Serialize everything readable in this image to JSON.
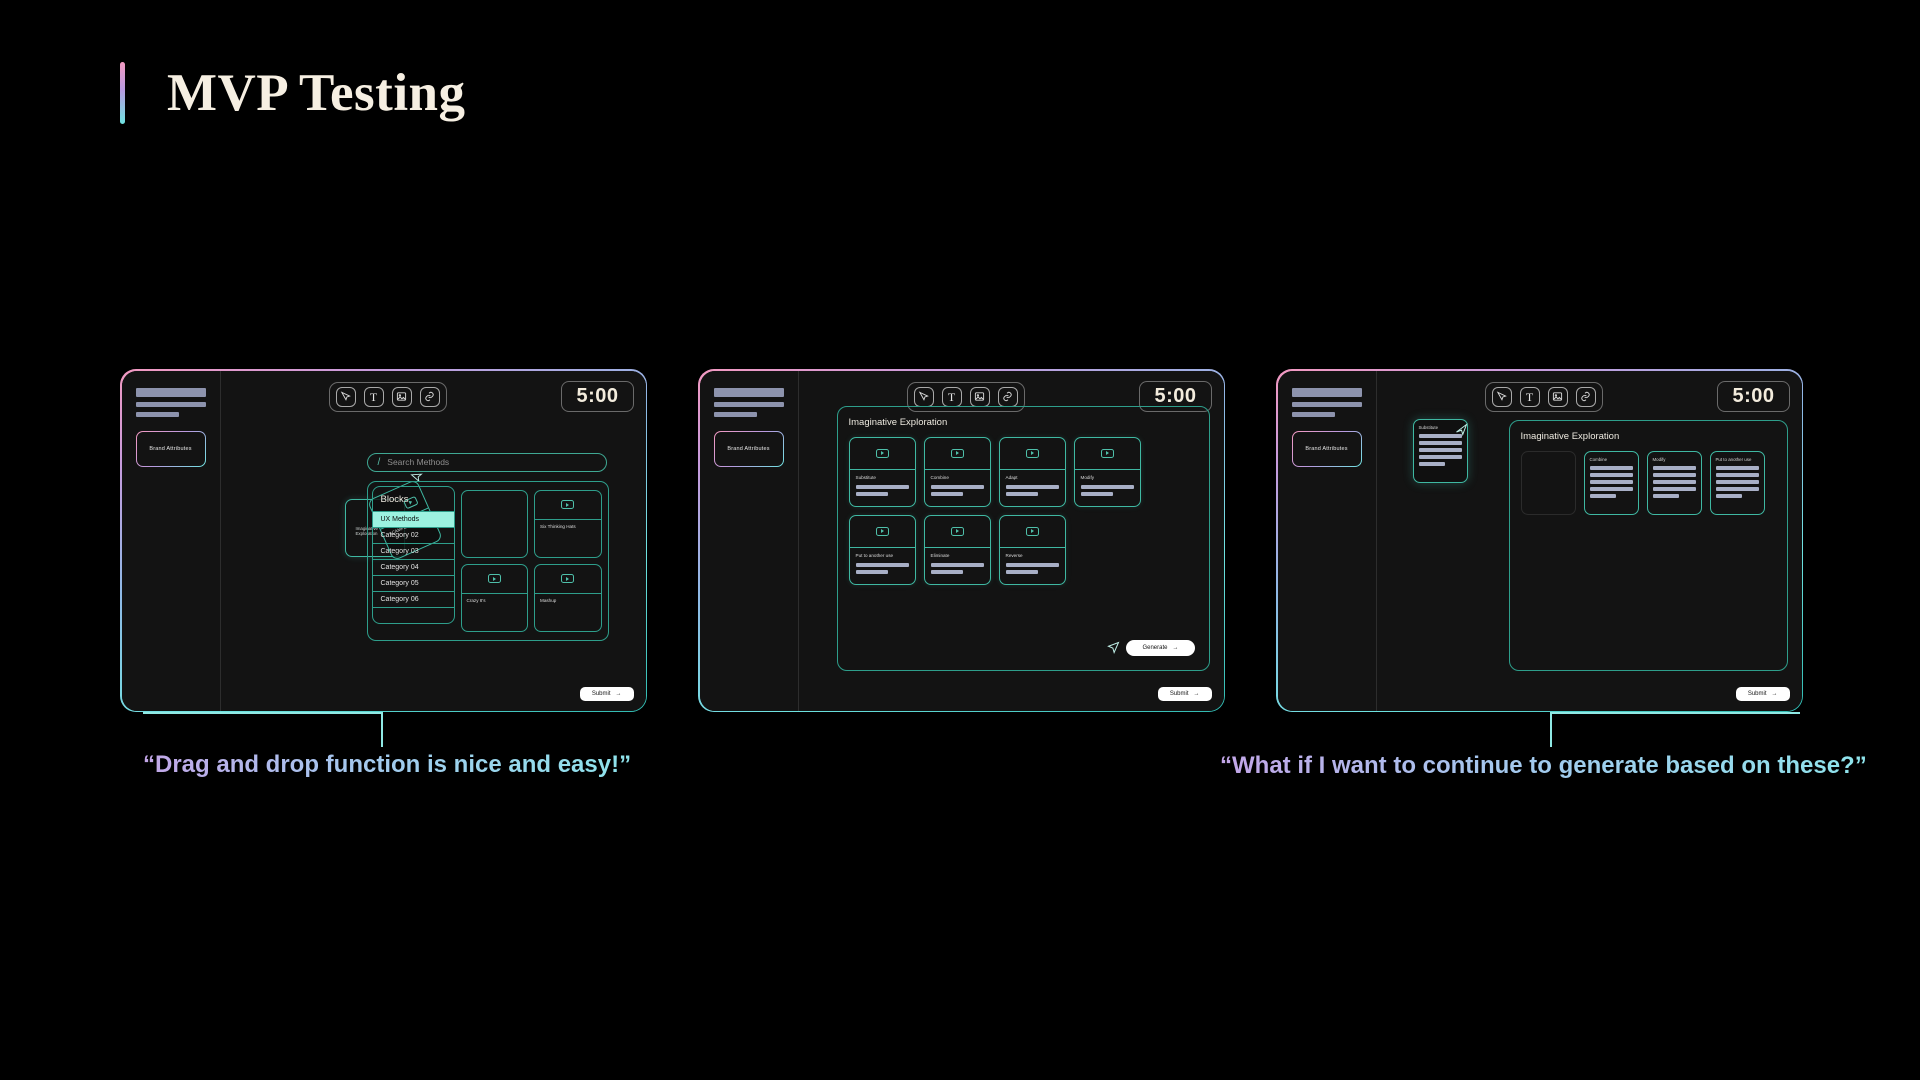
{
  "page": {
    "title": "MVP Testing",
    "background": "#000000",
    "accent_gradient": [
      "#f49ac1",
      "#6fe3e1"
    ],
    "caption_gradient": [
      "#c3a6e8",
      "#8ee4ec"
    ]
  },
  "app": {
    "toolbar": {
      "tools": [
        {
          "name": "pen-cursor-icon",
          "label": "Select"
        },
        {
          "name": "text-icon",
          "label": "T"
        },
        {
          "name": "image-icon",
          "label": "Image"
        },
        {
          "name": "link-icon",
          "label": "Link"
        }
      ]
    },
    "timer": "5:00",
    "sidebar": {
      "brand_attributes_label": "Brand Attributes",
      "placeholder_bars": 3
    },
    "submit_label": "Submit",
    "submit_arrow": "→"
  },
  "panel1": {
    "search": {
      "slash": "/",
      "placeholder": "Search Methods"
    },
    "blocks": {
      "title": "Blocks",
      "items": [
        {
          "label": "UX Methods",
          "active": true
        },
        {
          "label": "Category 02",
          "active": false
        },
        {
          "label": "Category 03",
          "active": false
        },
        {
          "label": "Category 04",
          "active": false
        },
        {
          "label": "Category 05",
          "active": false
        },
        {
          "label": "Category 06",
          "active": false
        }
      ]
    },
    "method_cards": [
      {
        "label": "",
        "empty": true
      },
      {
        "label": "Six Thinking Hats",
        "empty": false
      },
      {
        "label": "Crazy 8's",
        "empty": false
      },
      {
        "label": "Mashup",
        "empty": false
      }
    ],
    "drag": {
      "target_label": "Imaginative\nExploration",
      "dragged_label": "SCAMPER",
      "cursor": "arrow-cursor-icon"
    },
    "caption": "“Drag and drop function is nice and easy!”"
  },
  "panel2": {
    "board_title": "Imaginative Exploration",
    "cards": [
      {
        "name": "Substitute"
      },
      {
        "name": "Combine"
      },
      {
        "name": "Adapt"
      },
      {
        "name": "Modify"
      },
      {
        "name": "Put to another use"
      },
      {
        "name": "Eliminate"
      },
      {
        "name": "Reverse"
      }
    ],
    "generate_label": "Generate",
    "generate_arrow": "→"
  },
  "panel3": {
    "board_title": "Imaginative Exploration",
    "floating_card": {
      "name": "Substitute"
    },
    "cards": [
      {
        "name": "",
        "empty": true
      },
      {
        "name": "Combine",
        "empty": false
      },
      {
        "name": "Modify",
        "empty": false
      },
      {
        "name": "Put to another use",
        "empty": false
      }
    ],
    "caption": "“What if I want to continue to generate based on these?”"
  }
}
